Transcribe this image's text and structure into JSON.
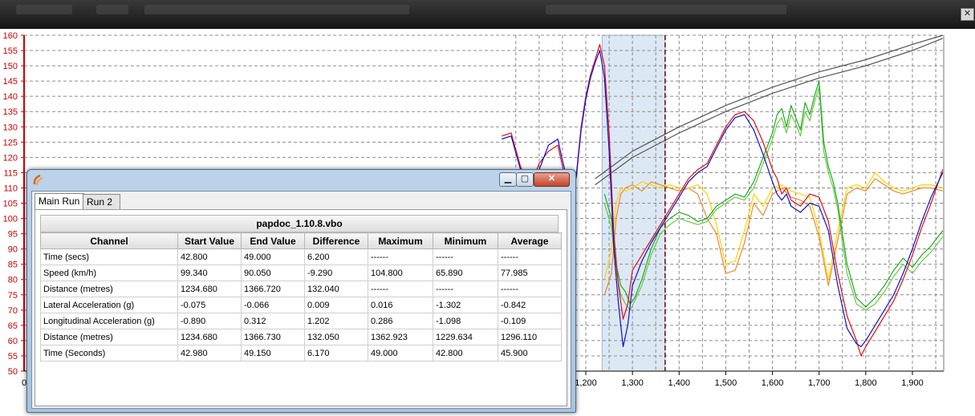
{
  "colors": {
    "axis_y": "#cc0000",
    "grid": "#8c8c8c",
    "highlight": "#dde8f5",
    "cursor": "#800000",
    "speed_run1": "#e01010",
    "speed_run2": "#1010d0",
    "lat_acc_1": "#22aa22",
    "lat_acc_2": "#66cc44",
    "long_acc_1": "#ffd400",
    "long_acc_2": "#f08a2a",
    "distance": "#555555"
  },
  "icons": {
    "window_close": "close-icon",
    "app_logo": "drift-logo-icon"
  },
  "chart_data": {
    "type": "line",
    "x_ticks": [
      "1,200",
      "1,300",
      "1,400",
      "1,500",
      "1,600",
      "1,700",
      "1,800",
      "1,900"
    ],
    "y_ticks": [
      "160",
      "155",
      "150",
      "145",
      "140",
      "135",
      "130",
      "125",
      "120",
      "115",
      "110",
      "105",
      "100",
      "95",
      "90",
      "85",
      "80",
      "75",
      "70",
      "65",
      "60",
      "55",
      "50"
    ],
    "xlim": [
      1020,
      1965
    ],
    "ylim": [
      50,
      160
    ],
    "x_origin_label": "0",
    "highlight_range": [
      1235,
      1370
    ],
    "cursor_x": 1370,
    "series": [
      {
        "key": "speed_run1",
        "x": [
          1020,
          1040,
          1060,
          1080,
          1100,
          1120,
          1140,
          1150,
          1160,
          1170,
          1180,
          1190,
          1200,
          1210,
          1220,
          1230,
          1240,
          1250,
          1260,
          1270,
          1280,
          1290,
          1300,
          1320,
          1340,
          1360,
          1380,
          1400,
          1420,
          1440,
          1460,
          1480,
          1500,
          1520,
          1540,
          1560,
          1580,
          1600,
          1610,
          1620,
          1630,
          1640,
          1660,
          1680,
          1700,
          1720,
          1740,
          1760,
          1780,
          1790,
          1800,
          1820,
          1840,
          1860,
          1880,
          1900,
          1920,
          1940,
          1965
        ],
        "y": [
          127,
          128,
          117,
          110,
          118,
          122,
          124,
          117,
          112,
          108,
          115,
          130,
          140,
          147,
          152,
          157,
          150,
          128,
          95,
          78,
          67,
          72,
          83,
          88,
          93,
          98,
          103,
          108,
          113,
          116,
          118,
          124,
          130,
          134,
          135,
          132,
          125,
          116,
          113,
          108,
          110,
          106,
          104,
          108,
          107,
          99,
          82,
          68,
          60,
          55,
          58,
          63,
          68,
          73,
          80,
          88,
          97,
          105,
          116
        ]
      },
      {
        "key": "speed_run2",
        "x": [
          1020,
          1040,
          1060,
          1080,
          1100,
          1120,
          1140,
          1150,
          1160,
          1170,
          1180,
          1190,
          1200,
          1210,
          1220,
          1230,
          1240,
          1250,
          1260,
          1270,
          1280,
          1290,
          1300,
          1320,
          1340,
          1360,
          1380,
          1400,
          1420,
          1440,
          1460,
          1480,
          1500,
          1520,
          1540,
          1560,
          1580,
          1600,
          1610,
          1620,
          1630,
          1640,
          1660,
          1680,
          1700,
          1720,
          1740,
          1760,
          1780,
          1790,
          1800,
          1820,
          1840,
          1860,
          1880,
          1900,
          1920,
          1940,
          1965
        ],
        "y": [
          126,
          127,
          116,
          109,
          116,
          124,
          126,
          119,
          113,
          107,
          114,
          129,
          139,
          146,
          151,
          155,
          146,
          122,
          90,
          72,
          58,
          65,
          78,
          86,
          92,
          97,
          102,
          107,
          112,
          115,
          117,
          123,
          129,
          133,
          134,
          129,
          121,
          112,
          108,
          106,
          108,
          104,
          102,
          105,
          104,
          96,
          78,
          64,
          59,
          58,
          60,
          65,
          70,
          75,
          82,
          90,
          99,
          107,
          115
        ]
      },
      {
        "key": "lat_acc_1",
        "x": [
          1240,
          1255,
          1265,
          1275,
          1285,
          1295,
          1305,
          1320,
          1340,
          1360,
          1380,
          1400,
          1420,
          1440,
          1460,
          1480,
          1500,
          1520,
          1540,
          1560,
          1580,
          1600,
          1610,
          1620,
          1630,
          1640,
          1650,
          1660,
          1670,
          1680,
          1690,
          1700,
          1710,
          1720,
          1730,
          1740,
          1750,
          1760,
          1780,
          1800,
          1820,
          1840,
          1860,
          1880,
          1900,
          1920,
          1940,
          1965
        ],
        "y": [
          108,
          100,
          85,
          78,
          76,
          72,
          74,
          80,
          90,
          97,
          100,
          102,
          101,
          99,
          100,
          104,
          106,
          108,
          107,
          112,
          120,
          128,
          134,
          136,
          130,
          137,
          133,
          129,
          138,
          134,
          140,
          145,
          125,
          117,
          112,
          105,
          95,
          85,
          74,
          71,
          74,
          78,
          83,
          87,
          84,
          88,
          91,
          96
        ]
      },
      {
        "key": "lat_acc_2",
        "x": [
          1240,
          1255,
          1265,
          1275,
          1285,
          1295,
          1305,
          1320,
          1340,
          1360,
          1380,
          1400,
          1420,
          1440,
          1460,
          1480,
          1500,
          1520,
          1540,
          1560,
          1580,
          1600,
          1610,
          1620,
          1630,
          1640,
          1650,
          1660,
          1670,
          1680,
          1690,
          1700,
          1710,
          1720,
          1730,
          1740,
          1750,
          1760,
          1780,
          1800,
          1820,
          1840,
          1860,
          1880,
          1900,
          1920,
          1940,
          1965
        ],
        "y": [
          105,
          97,
          83,
          75,
          72,
          70,
          73,
          78,
          88,
          95,
          98,
          100,
          99,
          98,
          99,
          103,
          105,
          107,
          106,
          110,
          118,
          126,
          131,
          133,
          128,
          134,
          131,
          127,
          135,
          132,
          138,
          143,
          122,
          115,
          110,
          103,
          92,
          82,
          72,
          70,
          72,
          76,
          81,
          85,
          82,
          86,
          89,
          94
        ]
      },
      {
        "key": "long_acc_1",
        "x": [
          1240,
          1255,
          1265,
          1275,
          1285,
          1300,
          1320,
          1340,
          1360,
          1380,
          1400,
          1420,
          1440,
          1460,
          1480,
          1500,
          1520,
          1540,
          1560,
          1580,
          1600,
          1620,
          1640,
          1660,
          1680,
          1700,
          1720,
          1740,
          1760,
          1780,
          1800,
          1820,
          1840,
          1860,
          1880,
          1900,
          1920,
          1940,
          1965
        ],
        "y": [
          80,
          90,
          105,
          110,
          109,
          110,
          112,
          111,
          110,
          111,
          110,
          110,
          111,
          108,
          98,
          85,
          86,
          96,
          108,
          104,
          110,
          111,
          109,
          108,
          107,
          96,
          80,
          96,
          110,
          111,
          110,
          115,
          112,
          110,
          109,
          110,
          111,
          111,
          110
        ]
      },
      {
        "key": "long_acc_2",
        "x": [
          1240,
          1255,
          1265,
          1275,
          1285,
          1300,
          1320,
          1340,
          1360,
          1380,
          1400,
          1420,
          1440,
          1460,
          1480,
          1500,
          1520,
          1540,
          1560,
          1580,
          1600,
          1620,
          1640,
          1660,
          1680,
          1700,
          1720,
          1740,
          1760,
          1780,
          1800,
          1820,
          1840,
          1860,
          1880,
          1900,
          1920,
          1940,
          1965
        ],
        "y": [
          75,
          82,
          100,
          108,
          110,
          111,
          109,
          112,
          111,
          110,
          109,
          110,
          108,
          100,
          95,
          82,
          83,
          92,
          105,
          101,
          108,
          110,
          107,
          106,
          104,
          94,
          78,
          93,
          108,
          110,
          109,
          113,
          111,
          109,
          108,
          109,
          110,
          110,
          109
        ]
      },
      {
        "key": "distance",
        "x": [
          1220,
          1300,
          1400,
          1500,
          1600,
          1700,
          1800,
          1900,
          1965
        ],
        "y": [
          113,
          122,
          130,
          137,
          143,
          148,
          152,
          157,
          160
        ]
      },
      {
        "key": "distance",
        "x": [
          1220,
          1300,
          1400,
          1500,
          1600,
          1700,
          1800,
          1900,
          1965
        ],
        "y": [
          111,
          120,
          128,
          135,
          141,
          146,
          150,
          155,
          159
        ]
      }
    ]
  },
  "dialog": {
    "tabs": [
      "Main Run",
      "Run 2"
    ],
    "table_title": "papdoc_1.10.8.vbo",
    "headers": [
      "Channel",
      "Start Value",
      "End Value",
      "Difference",
      "Maximum",
      "Minimum",
      "Average"
    ],
    "rows": [
      [
        "Time (secs)",
        "42.800",
        "49.000",
        "6.200",
        "------",
        "------",
        "------"
      ],
      [
        "Speed (km/h)",
        "99.340",
        "90.050",
        "-9.290",
        "104.800",
        "65.890",
        "77.985"
      ],
      [
        "Distance (metres)",
        "1234.680",
        "1366.720",
        "132.040",
        "------",
        "------",
        "------"
      ],
      [
        "Lateral Acceleration (g)",
        "-0.075",
        "-0.066",
        "0.009",
        "0.016",
        "-1.302",
        "-0.842"
      ],
      [
        "Longitudinal Acceleration (g)",
        "-0.890",
        "0.312",
        "1.202",
        "0.286",
        "-1.098",
        "-0.109"
      ],
      [
        "Distance (metres)",
        "1234.680",
        "1366.730",
        "132.050",
        "1362.923",
        "1229.634",
        "1296.110"
      ],
      [
        "Time (Seconds)",
        "42.980",
        "49.150",
        "6.170",
        "49.000",
        "42.800",
        "45.900"
      ]
    ],
    "col_widths": [
      170,
      78,
      78,
      78,
      80,
      80,
      78
    ]
  }
}
